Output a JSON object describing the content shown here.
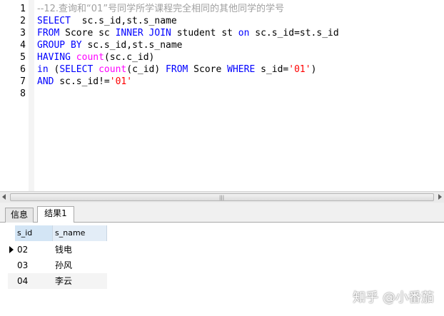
{
  "editor": {
    "lines": [
      {
        "num": "1",
        "parts": [
          {
            "t": "--12.查询和“01”号同学所学课程完全相同的其他同学的学号",
            "c": "cm"
          }
        ]
      },
      {
        "num": "2",
        "parts": [
          {
            "t": "SELECT",
            "c": "kw"
          },
          {
            "t": "  sc.s_id,st.s_name",
            "c": "plain"
          }
        ]
      },
      {
        "num": "3",
        "parts": [
          {
            "t": "FROM",
            "c": "kw"
          },
          {
            "t": " Score sc ",
            "c": "plain"
          },
          {
            "t": "INNER JOIN",
            "c": "kw"
          },
          {
            "t": " student st ",
            "c": "plain"
          },
          {
            "t": "on",
            "c": "kw"
          },
          {
            "t": " sc.s_id=st.s_id",
            "c": "plain"
          }
        ]
      },
      {
        "num": "4",
        "parts": [
          {
            "t": "GROUP BY",
            "c": "kw"
          },
          {
            "t": " sc.s_id,st.s_name",
            "c": "plain"
          }
        ]
      },
      {
        "num": "5",
        "parts": [
          {
            "t": "HAVING",
            "c": "kw"
          },
          {
            "t": " ",
            "c": "plain"
          },
          {
            "t": "count",
            "c": "fn"
          },
          {
            "t": "(sc.c_id)",
            "c": "plain"
          }
        ]
      },
      {
        "num": "6",
        "parts": [
          {
            "t": "in",
            "c": "kw"
          },
          {
            "t": " (",
            "c": "plain"
          },
          {
            "t": "SELECT",
            "c": "kw"
          },
          {
            "t": " ",
            "c": "plain"
          },
          {
            "t": "count",
            "c": "fn"
          },
          {
            "t": "(c_id) ",
            "c": "plain"
          },
          {
            "t": "FROM",
            "c": "kw"
          },
          {
            "t": " Score ",
            "c": "plain"
          },
          {
            "t": "WHERE",
            "c": "kw"
          },
          {
            "t": " s_id=",
            "c": "plain"
          },
          {
            "t": "'01'",
            "c": "str"
          },
          {
            "t": ")",
            "c": "plain"
          }
        ]
      },
      {
        "num": "7",
        "parts": [
          {
            "t": "AND",
            "c": "kw"
          },
          {
            "t": " sc.s_id!=",
            "c": "plain"
          },
          {
            "t": "'01'",
            "c": "str"
          }
        ]
      },
      {
        "num": "8",
        "parts": []
      }
    ]
  },
  "scrollbar": {
    "grip": "|||"
  },
  "tabs": [
    {
      "label": "信息",
      "active": false
    },
    {
      "label": "结果1",
      "active": true
    }
  ],
  "results": {
    "columns": [
      "s_id",
      "s_name"
    ],
    "rows": [
      {
        "s_id": "02",
        "s_name": "钱电"
      },
      {
        "s_id": "03",
        "s_name": "孙风"
      },
      {
        "s_id": "04",
        "s_name": "李云"
      }
    ],
    "current_row": 0
  },
  "watermark": "知乎 @小番茄",
  "colors": {
    "keyword": "#0000ff",
    "function": "#ff00ff",
    "string": "#ff0000",
    "comment": "#a0a0a0",
    "header_bg": "#e3edf7"
  }
}
